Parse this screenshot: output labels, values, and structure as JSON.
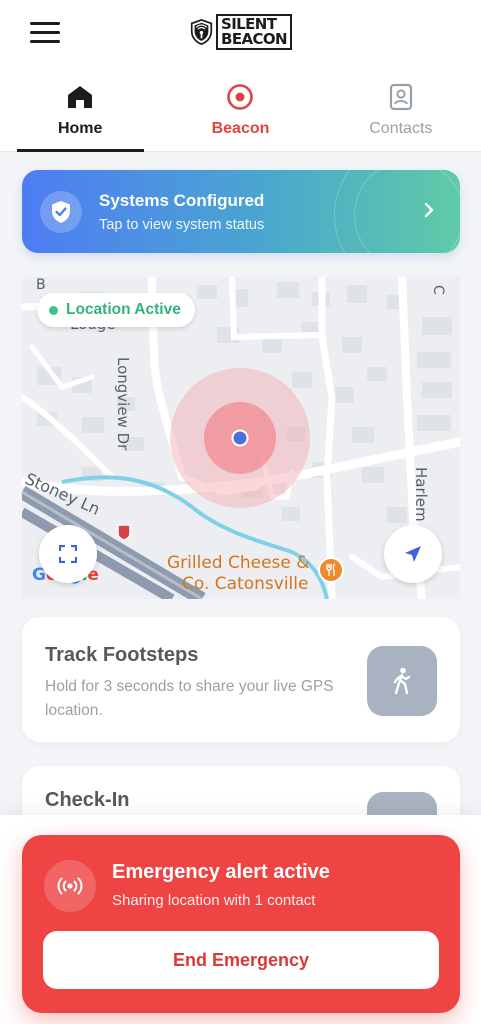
{
  "header": {
    "menu_icon": "hamburger-menu-icon",
    "logo_line1": "SILENT",
    "logo_line2": "BEACON"
  },
  "tabs": [
    {
      "label": "Home",
      "icon": "home-icon",
      "active": true
    },
    {
      "label": "Beacon",
      "icon": "target-icon"
    },
    {
      "label": "Contacts",
      "icon": "contact-card-icon"
    }
  ],
  "banner": {
    "title": "Systems Configured",
    "subtitle": "Tap to view system status",
    "icon": "shield-check-icon"
  },
  "map": {
    "status_label": "Location Active",
    "streets": [
      "Longview Dr",
      "Stoney Ln",
      "Harlem"
    ],
    "poi_line1": "Grilled Cheese &",
    "poi_line2": "Co. Catonsville",
    "partial_label": "Lodge",
    "google_label": "Google"
  },
  "cards": {
    "track": {
      "title": "Track Footsteps",
      "description": "Hold for 3 seconds to share your live GPS location.",
      "icon": "walking-person-icon"
    },
    "checkin": {
      "title": "Check-In"
    }
  },
  "emergency": {
    "title": "Emergency alert active",
    "subtitle": "Sharing location with 1 contact",
    "button": "End Emergency",
    "icon": "broadcast-icon"
  },
  "colors": {
    "accent_red": "#ee4444",
    "active_green": "#33b37a",
    "banner_start": "#4e7cf4",
    "banner_end": "#5fcba6"
  }
}
